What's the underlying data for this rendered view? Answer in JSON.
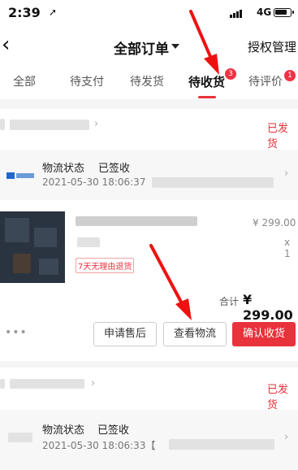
{
  "status_bar": {
    "time": "2:39",
    "network": "4G"
  },
  "nav": {
    "back_icon": "chevron-left-icon",
    "title": "全部订单",
    "manage_label": "授权管理"
  },
  "tabs": [
    {
      "label": "全部"
    },
    {
      "label": "待支付"
    },
    {
      "label": "待发货"
    },
    {
      "label": "待收货",
      "badge": "3"
    },
    {
      "label": "待评价",
      "badge": "1"
    }
  ],
  "orders": [
    {
      "status": "已发货",
      "logistics_title": "物流状态",
      "logistics_state": "已签收",
      "logistics_time": "2021-05-30 18:06:37",
      "price": "¥ 299.00",
      "qty": "x 1",
      "tag": "7天无理由退货",
      "total_label": "合计",
      "total_value": "¥ 299.00",
      "more": "•••",
      "buttons": {
        "after_sale": "申请售后",
        "view_logistics": "查看物流",
        "confirm": "确认收货"
      }
    },
    {
      "status": "已发货",
      "logistics_title": "物流状态",
      "logistics_state": "已签收",
      "logistics_time": "2021-05-30 18:06:33【"
    }
  ],
  "colors": {
    "accent": "#e8323c",
    "badge": "#ee3344",
    "annotation_arrow": "#ee1111"
  }
}
